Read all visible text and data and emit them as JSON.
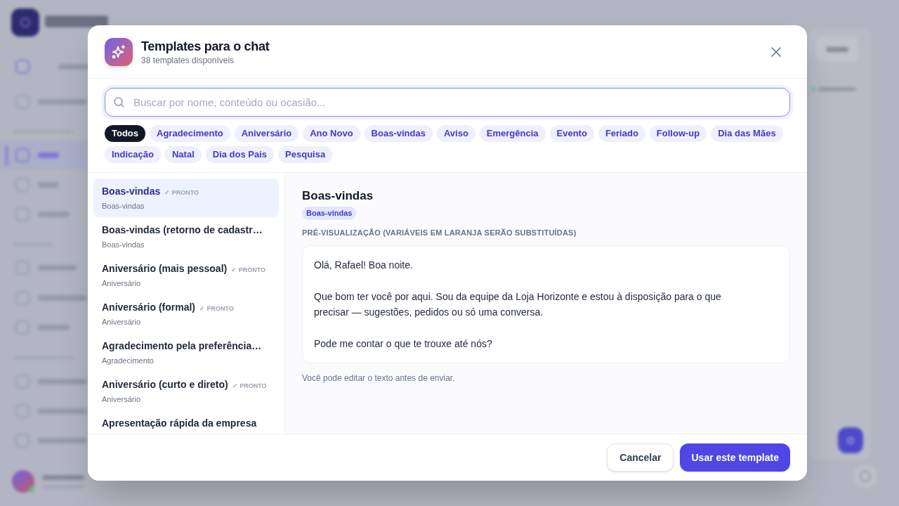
{
  "dialog": {
    "title": "Templates para o chat",
    "subtitle": "38 templates disponíveis"
  },
  "search": {
    "placeholder": "Buscar por nome, conteúdo ou ocasião..."
  },
  "filters": [
    {
      "label": "Todos",
      "selected": true
    },
    {
      "label": "Agradecimento",
      "selected": false
    },
    {
      "label": "Aniversário",
      "selected": false
    },
    {
      "label": "Ano Novo",
      "selected": false
    },
    {
      "label": "Boas-vindas",
      "selected": false
    },
    {
      "label": "Aviso",
      "selected": false
    },
    {
      "label": "Emergência",
      "selected": false
    },
    {
      "label": "Evento",
      "selected": false
    },
    {
      "label": "Feriado",
      "selected": false
    },
    {
      "label": "Follow-up",
      "selected": false
    },
    {
      "label": "Dia das Mães",
      "selected": false
    },
    {
      "label": "Indicação",
      "selected": false
    },
    {
      "label": "Natal",
      "selected": false
    },
    {
      "label": "Dia dos Pais",
      "selected": false
    },
    {
      "label": "Pesquisa",
      "selected": false
    }
  ],
  "templates": [
    {
      "title": "Boas-vindas",
      "badge": "✓ PRONTO",
      "category": "Boas-vindas",
      "selected": true
    },
    {
      "title": "Boas-vindas (retorno de cadastr…",
      "category": "Boas-vindas",
      "selected": false
    },
    {
      "title": "Aniversário (mais pessoal)",
      "badge": "✓ PRONTO",
      "category": "Aniversário",
      "selected": false
    },
    {
      "title": "Aniversário (formal)",
      "badge": "✓ PRONTO",
      "category": "Aniversário",
      "selected": false
    },
    {
      "title": "Agradecimento pela preferência…",
      "category": "Agradecimento",
      "selected": false
    },
    {
      "title": "Aniversário (curto e direto)",
      "badge": "✓ PRONTO",
      "category": "Aniversário",
      "selected": false
    },
    {
      "title": "Apresentação rápida da empresa",
      "selected": false
    }
  ],
  "preview": {
    "title": "Boas-vindas",
    "tag": "Boas-vindas",
    "label": "PRÉ-VISUALIZAÇÃO (VARIÁVEIS EM LARANJA SERÃO SUBSTITUÍDAS)",
    "paragraphs": [
      "Olá, Rafael! Boa noite.",
      "Que bom ter você por aqui. Sou da equipe da Loja Horizonte e estou à disposição para o que precisar — sugestões, pedidos ou só uma conversa.",
      "Pode me contar o que te trouxe até nós?"
    ],
    "hint": "Você pode editar o texto antes de enviar."
  },
  "buttons": [
    {
      "label": "Cancelar",
      "kind": "secondary"
    },
    {
      "label": "Usar este template",
      "kind": "primary"
    }
  ]
}
